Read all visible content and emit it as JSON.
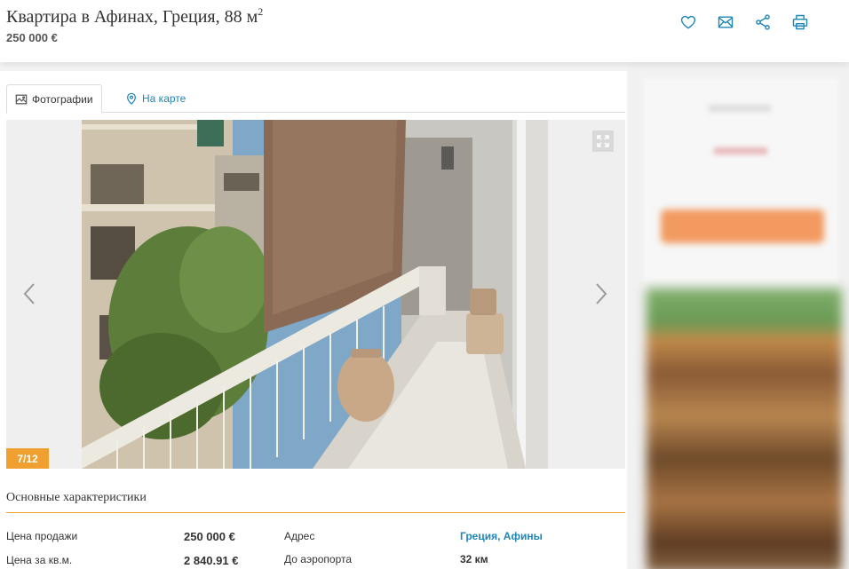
{
  "listing": {
    "title": "Квартира в Афинах, Греция, 88 м",
    "title_sup": "2",
    "price": "250 000 €"
  },
  "actions": {
    "favorite_icon": "heart-icon",
    "email_icon": "mail-icon",
    "share_icon": "share-icon",
    "print_icon": "printer-icon"
  },
  "tabs": [
    {
      "label": "Фотографии",
      "icon": "image-icon",
      "active": true
    },
    {
      "label": "На карте",
      "icon": "map-pin-icon",
      "active": false
    }
  ],
  "gallery": {
    "counter": "7/12",
    "prev_icon": "chevron-left-icon",
    "next_icon": "chevron-right-icon",
    "expand_icon": "expand-icon"
  },
  "characteristics": {
    "title": "Основные характеристики",
    "rows": [
      {
        "label": "Цена продажи",
        "value": "250 000 €"
      },
      {
        "label": "Цена за кв.м.",
        "value": "2 840.91 €"
      }
    ],
    "right_rows": [
      {
        "label": "Адрес",
        "value": "Греция, Афины"
      },
      {
        "label": "До аэропорта",
        "value": "32 км"
      }
    ]
  },
  "colors": {
    "accent": "#1f86b8",
    "badge": "#f0a030",
    "section_line": "#f0a030"
  }
}
